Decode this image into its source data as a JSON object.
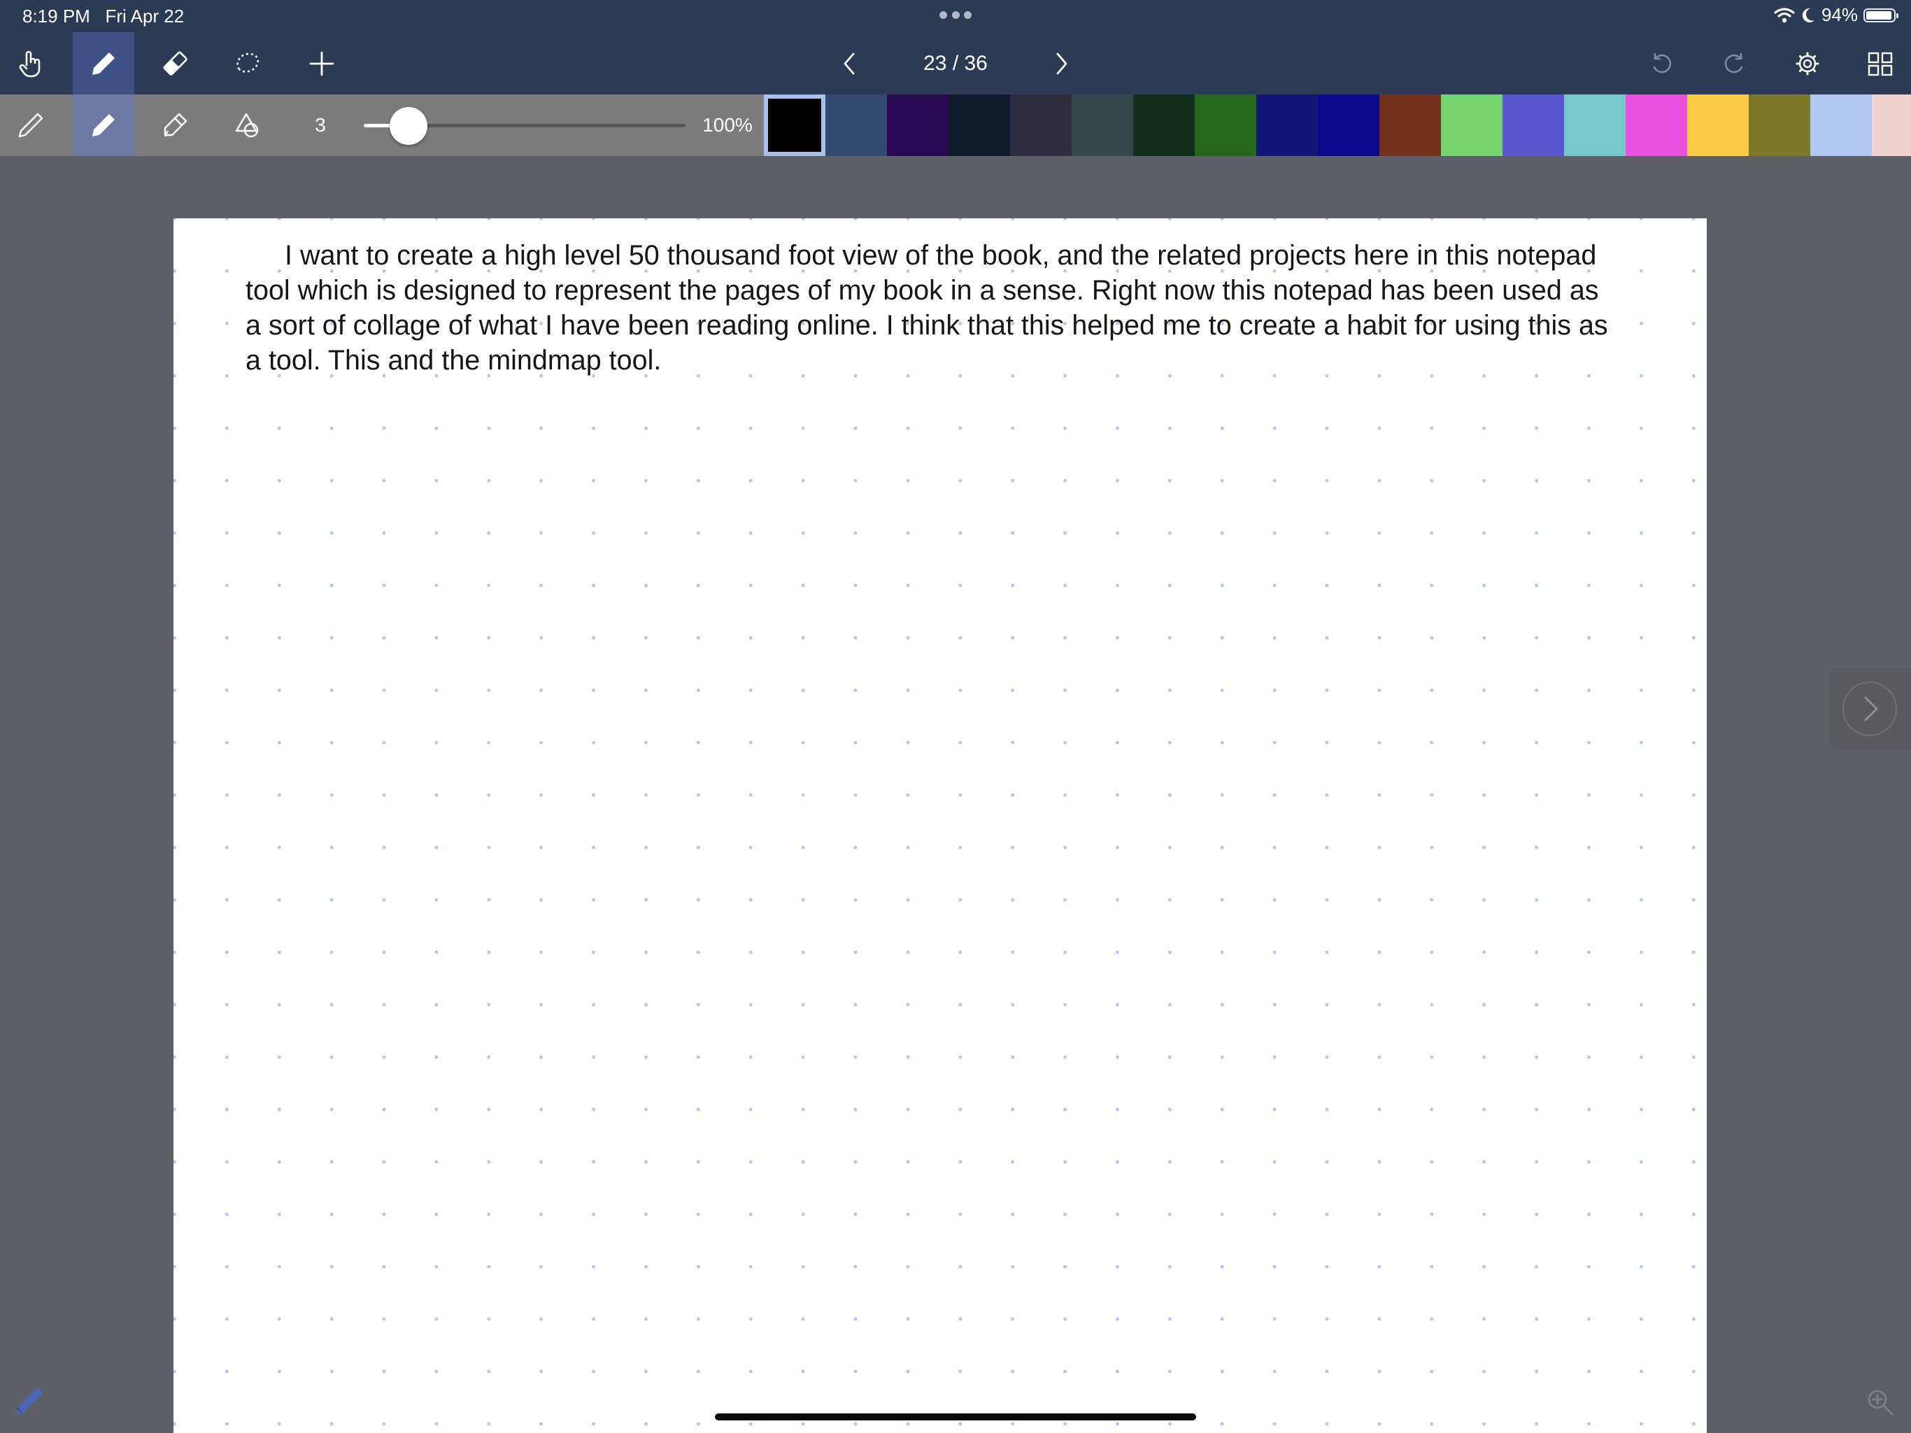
{
  "status_bar": {
    "time": "8:19 PM",
    "date": "Fri Apr 22",
    "battery": "94%",
    "icons": [
      "multitask-dots-icon",
      "wifi-icon",
      "moon-icon",
      "battery-icon"
    ]
  },
  "toolbar": {
    "tools": [
      "hand-icon",
      "pen-icon",
      "eraser-icon",
      "lasso-icon",
      "plus-icon"
    ],
    "active_tool": "pen-icon",
    "page_indicator": "23 / 36",
    "right_icons": [
      "undo-icon",
      "redo-icon",
      "settings-icon",
      "grid-view-icon"
    ]
  },
  "pen_bar": {
    "pen_types": [
      "fine-pen-icon",
      "marker-pen-icon",
      "highlighter-icon",
      "shapes-icon"
    ],
    "active_pen": "marker-pen-icon",
    "stroke_size": "3",
    "stroke_slider_level": 0.08,
    "opacity": "100%",
    "selected_color": "#000000",
    "colors": [
      "#000000",
      "#2f4a6e",
      "#2b0a55",
      "#121b2d",
      "#2e2e3e",
      "#35474a",
      "#0f2e1b",
      "#27671b",
      "#111878",
      "#0a0a8c",
      "#73301a",
      "#76d470",
      "#5c55d0",
      "#76c8cc",
      "#ea50e0",
      "#f9cb46",
      "#7c7827",
      "#b1c8f1",
      "#f2d3d2"
    ]
  },
  "canvas": {
    "paper": "dot-grid",
    "text": "I want to create a high level 50 thousand foot view of the book, and the related projects here in this notepad tool which is designed to represent the pages of my book in a sense. Right now this notepad has been used as a sort of collage of what I have been reading online. I think that this helped me to create a habit for using this as a tool. This and the mindmap tool."
  },
  "overlay": {
    "icons": [
      "next-page-chevron-icon",
      "pencil-icon",
      "zoom-in-icon"
    ]
  }
}
